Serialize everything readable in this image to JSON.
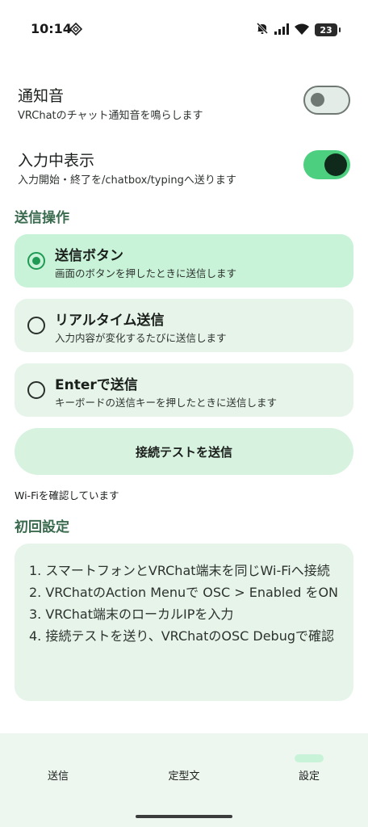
{
  "status_bar": {
    "time": "10:14",
    "battery": "23"
  },
  "settings": {
    "notification_sound": {
      "title": "通知音",
      "description": "VRChatのチャット通知音を鳴らします",
      "enabled": false
    },
    "typing_indicator": {
      "title": "入力中表示",
      "description": "入力開始・終了を/chatbox/typingへ送ります",
      "enabled": true
    }
  },
  "send_section": {
    "header": "送信操作",
    "options": [
      {
        "title": "送信ボタン",
        "description": "画面のボタンを押したときに送信します",
        "selected": true
      },
      {
        "title": "リアルタイム送信",
        "description": "入力内容が変化するたびに送信します",
        "selected": false
      },
      {
        "title": "Enterで送信",
        "description": "キーボードの送信キーを押したときに送信します",
        "selected": false
      }
    ],
    "test_button_label": "接続テストを送信",
    "wifi_status": "Wi-Fiを確認しています"
  },
  "setup_section": {
    "header": "初回設定",
    "steps": [
      "1. スマートフォンとVRChat端末を同じWi-Fiへ接続",
      "2. VRChatのAction Menuで OSC > Enabled をON",
      "3. VRChat端末のローカルIPを入力",
      "4. 接続テストを送り、VRChatのOSC Debugで確認"
    ]
  },
  "bottom_nav": {
    "items": [
      {
        "label": "送信",
        "active": false
      },
      {
        "label": "定型文",
        "active": false
      },
      {
        "label": "設定",
        "active": true
      }
    ]
  },
  "colors": {
    "accent": "#4ccf7e",
    "selected_card": "#c8f3d8",
    "card": "#e6f4ea",
    "section_header": "#3a6b4e"
  }
}
